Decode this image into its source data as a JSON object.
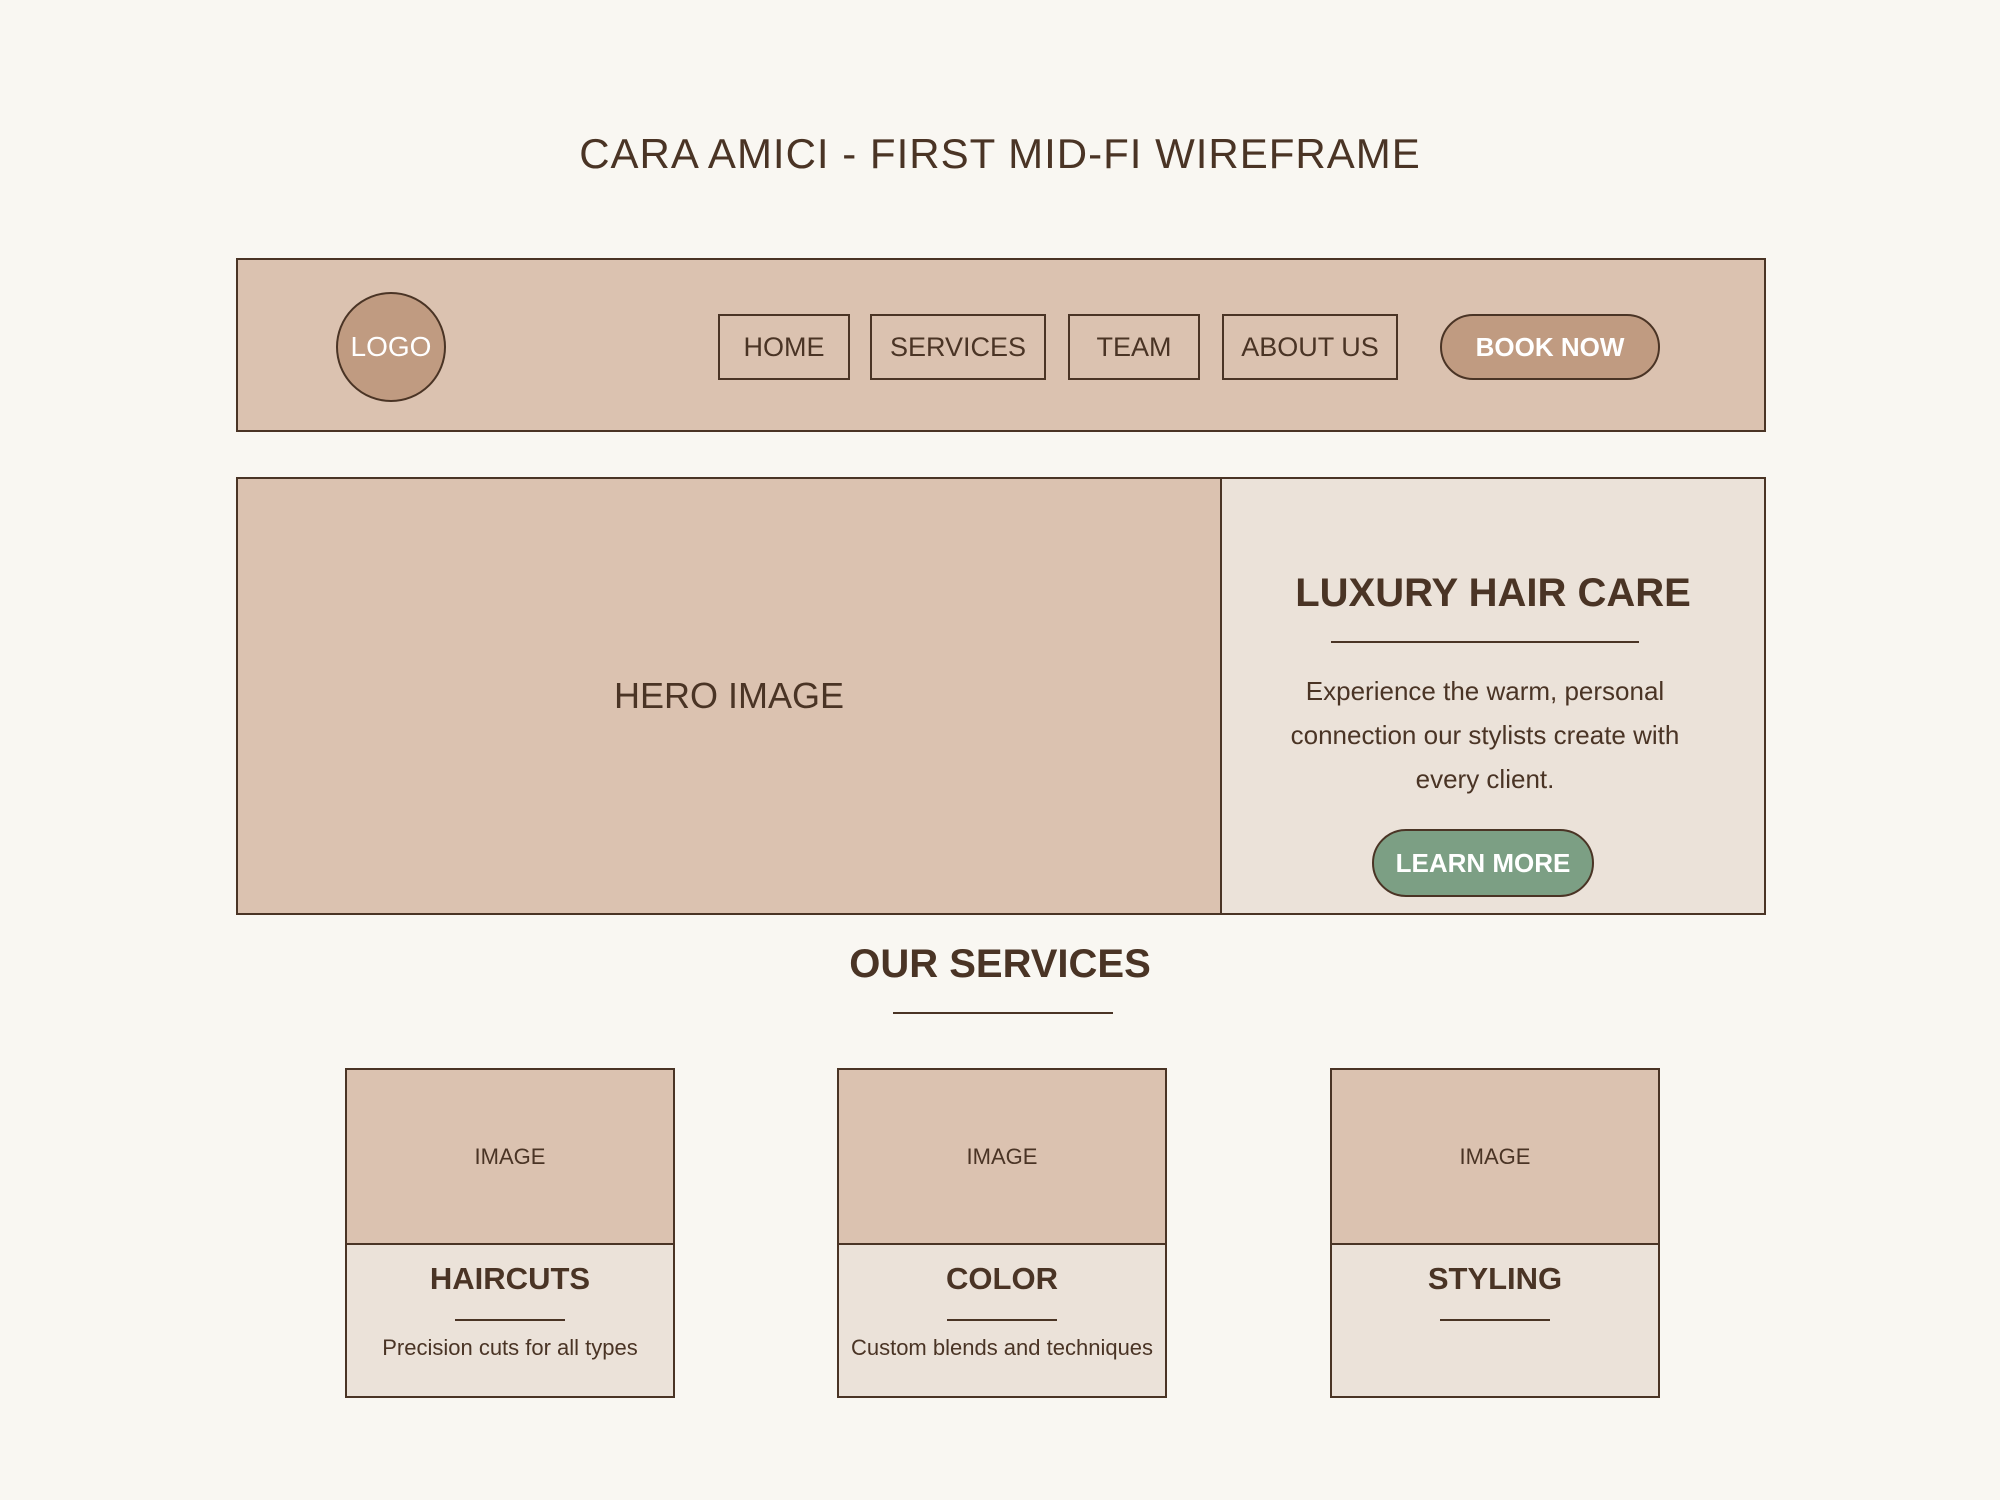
{
  "page": {
    "title": "CARA AMICI - FIRST MID-FI WIREFRAME"
  },
  "header": {
    "logo_label": "LOGO",
    "nav": [
      {
        "label": "HOME"
      },
      {
        "label": "SERVICES"
      },
      {
        "label": "TEAM"
      },
      {
        "label": "ABOUT US"
      }
    ],
    "cta_label": "BOOK NOW"
  },
  "hero": {
    "image_label": "HERO IMAGE",
    "heading": "LUXURY HAIR CARE",
    "body": "Experience the warm, personal connection our stylists create with every client.",
    "button_label": "LEARN MORE"
  },
  "services": {
    "heading": "OUR SERVICES",
    "cards": [
      {
        "image_label": "IMAGE",
        "title": "HAIRCUTS",
        "description": "Precision cuts for all types"
      },
      {
        "image_label": "IMAGE",
        "title": "COLOR",
        "description": "Custom blends and techniques"
      },
      {
        "image_label": "IMAGE",
        "title": "STYLING",
        "description": ""
      }
    ]
  },
  "colors": {
    "background": "#f9f7f2",
    "primary_tan": "#dbc2b0",
    "accent_brown": "#c09b81",
    "panel_cream": "#ebe2d9",
    "sage_green": "#7c9f84",
    "text_dark": "#4a3425"
  }
}
